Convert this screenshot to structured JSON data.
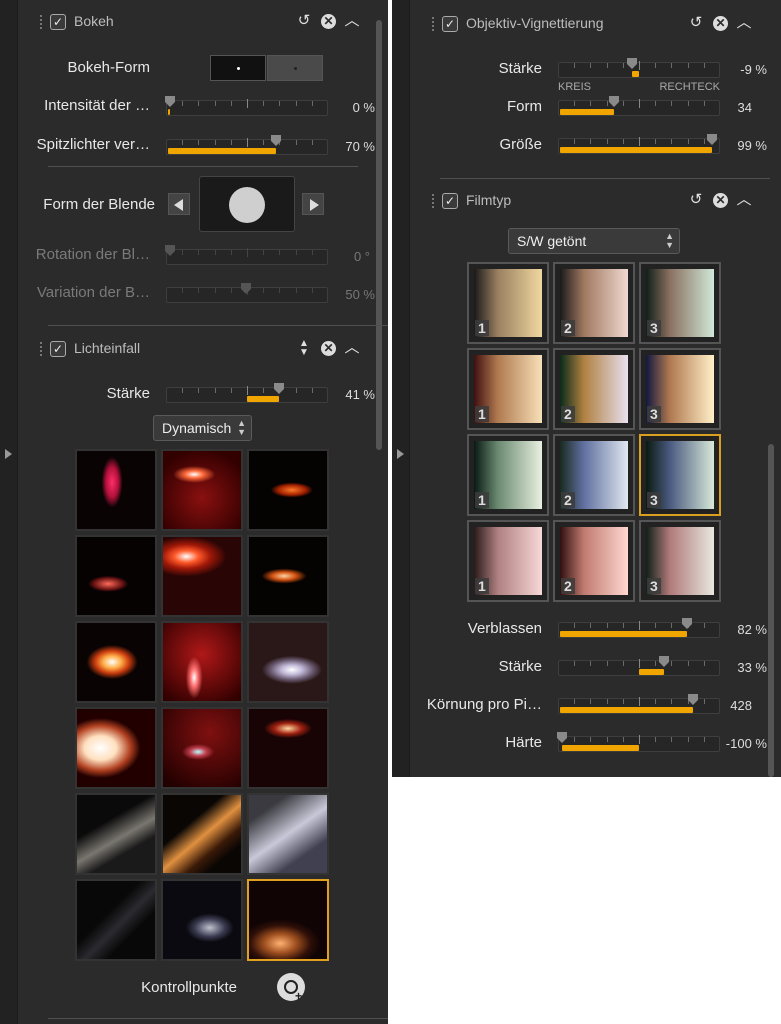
{
  "left": {
    "bokeh": {
      "title": "Bokeh",
      "form_label": "Bokeh-Form",
      "rows": [
        {
          "label": "Intensität der …",
          "value": "0 %",
          "pct": 0
        },
        {
          "label": "Spitzlichter ver…",
          "value": "70 %",
          "pct": 70
        }
      ],
      "aperture_label": "Form der Blende",
      "dim_rows": [
        {
          "label": "Rotation der Bl…",
          "value": "0 °",
          "pct": 0
        },
        {
          "label": "Variation der B…",
          "value": "50 %",
          "pct": 50
        }
      ]
    },
    "light": {
      "title": "Lichteinfall",
      "strength_label": "Stärke",
      "strength_value": "41 %",
      "strength": 41,
      "mode": "Dynamisch",
      "selected_index": 17,
      "control_points_label": "Kontrollpunkte"
    }
  },
  "right": {
    "vignette": {
      "title": "Objektiv-Vignettierung",
      "strength_label": "Stärke",
      "strength_value": "-9 %",
      "strength": -9,
      "form_label": "Form",
      "form_value": "34",
      "form": 34,
      "form_min_label": "KREIS",
      "form_max_label": "RECHTECK",
      "size_label": "Größe",
      "size_value": "99 %",
      "size": 99
    },
    "film": {
      "title": "Filmtyp",
      "type": "S/W getönt",
      "selected_index": 8,
      "numbers": [
        "1",
        "2",
        "3",
        "1",
        "2",
        "3",
        "1",
        "2",
        "3",
        "1",
        "2",
        "3"
      ],
      "rows": [
        {
          "label": "Verblassen",
          "value": "82 %",
          "pct": 82
        },
        {
          "label": "Stärke",
          "value": "33 %",
          "pct": 33,
          "centered": true
        },
        {
          "label": "Körnung pro Pi…",
          "value": "428",
          "pct": 86
        },
        {
          "label": "Härte",
          "value": "-100 %",
          "pct": -100,
          "centered": true
        }
      ]
    }
  },
  "colors": {
    "accent": "#f0a500",
    "panel": "#2b2b2b",
    "selection": "#e0a020"
  }
}
